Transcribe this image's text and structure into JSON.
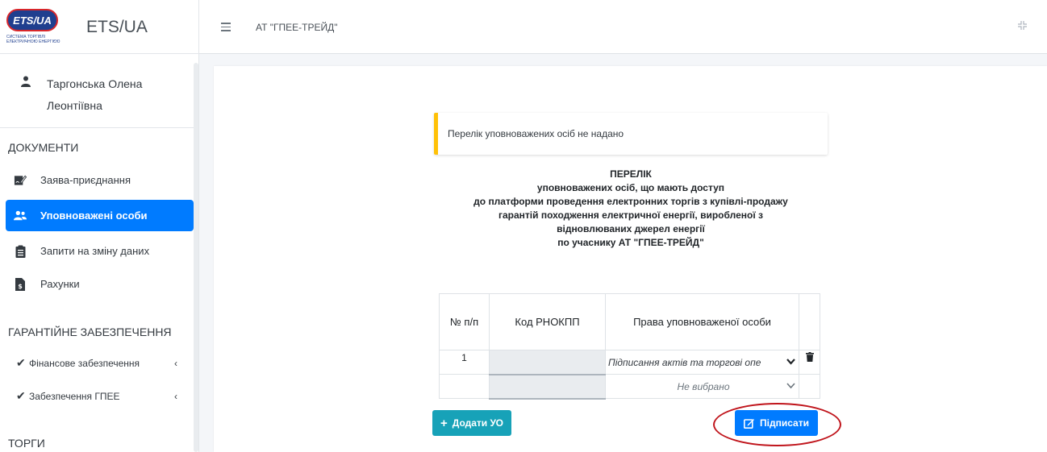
{
  "brand": {
    "logo_text": "ETS/UA",
    "logo_subtitle": "СИСТЕМА ТОРГІВЛІ ЕЛЕКТРИЧНОЮ ЕНЕРГІЄЮ",
    "name": "ETS/UA"
  },
  "user": {
    "name": "Таргонська Олена Леонтіївна"
  },
  "sidebar": {
    "documents_header": "ДОКУМЕНТИ",
    "items": [
      {
        "label": "Заява-приєднання",
        "icon": "signature-icon"
      },
      {
        "label": "Уповноважені особи",
        "icon": "users-icon",
        "active": true
      },
      {
        "label": "Запити на зміну даних",
        "icon": "clipboard-icon"
      },
      {
        "label": "Рахунки",
        "icon": "invoice-icon"
      }
    ],
    "guarantee_header": "ГАРАНТІЙНЕ ЗАБЕЗПЕЧЕННЯ",
    "sub_items": [
      {
        "label": "Фінансове забезпечення"
      },
      {
        "label": "Забезпечення ГПЕЕ"
      }
    ],
    "trading_header": "ТОРГИ"
  },
  "topbar": {
    "title": "АТ \"ГПЕЕ-ТРЕЙД\""
  },
  "notice": {
    "text": "Перелік уповноважених осіб не надано"
  },
  "document": {
    "title_lines": [
      "ПЕРЕЛІК",
      "уповноважених осіб, що мають доступ",
      "до платформи проведення електронних торгів з купівлі-продажу",
      "гарантій походження електричної енергії, виробленої з",
      "відновлюваних джерел енергії",
      "по учаснику АТ \"ГПЕЕ-ТРЕЙД\""
    ]
  },
  "table": {
    "headers": [
      "№ п/п",
      "Код РНОКПП",
      "Права уповноваженої особи",
      ""
    ],
    "rows": [
      {
        "num": "1",
        "code": "",
        "rights": "Підписання актів та торгові опе"
      },
      {
        "num": "",
        "code": "",
        "rights": "Не вибрано"
      }
    ]
  },
  "actions": {
    "add_label": "Додати УО",
    "sign_label": "Підписати"
  },
  "colors": {
    "primary": "#007bff",
    "info": "#17a2b8",
    "warning": "#ffc107",
    "highlight": "#c0151c"
  }
}
